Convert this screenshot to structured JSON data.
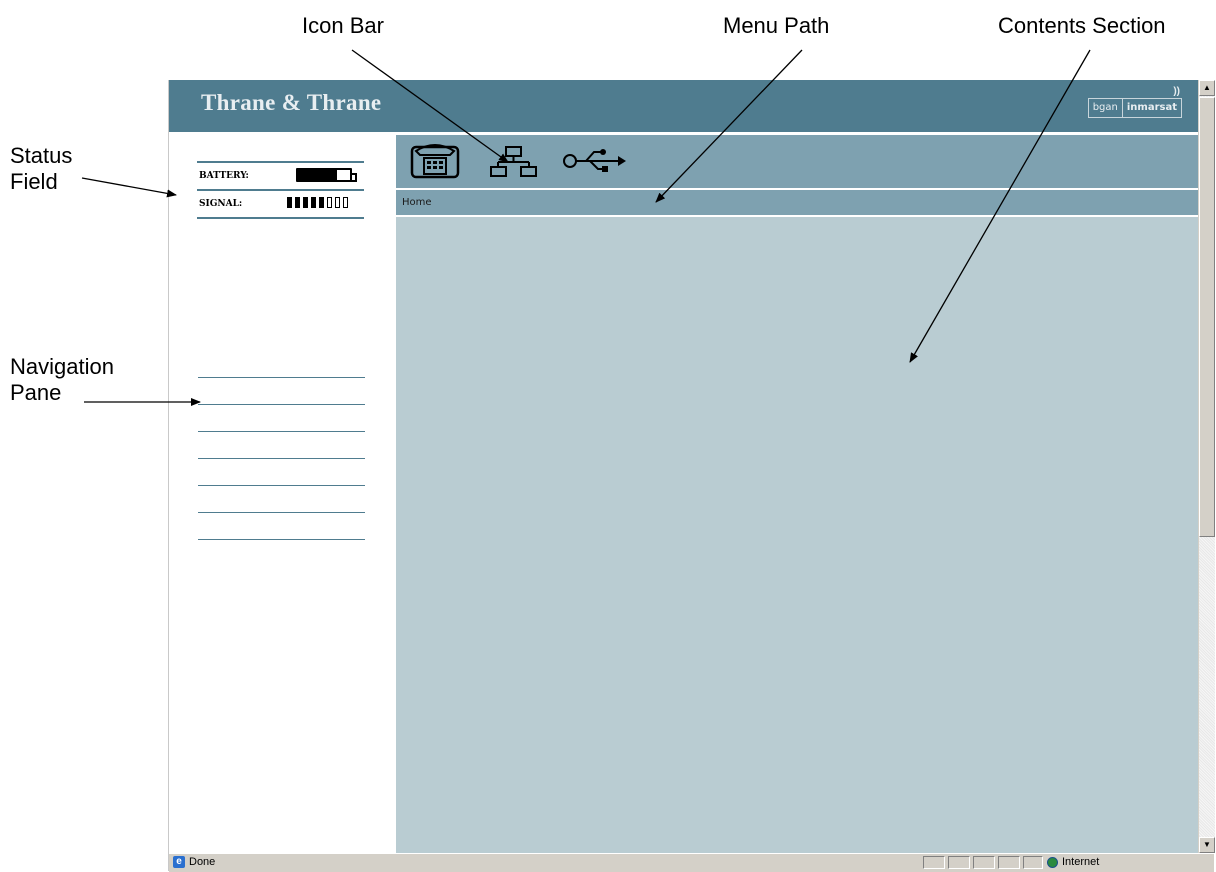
{
  "callouts": {
    "icon_bar": "Icon Bar",
    "menu_path": "Menu Path",
    "contents_section": "Contents Section",
    "status_field_line1": "Status",
    "status_field_line2": "Field",
    "navigation_pane_line1": "Navigation",
    "navigation_pane_line2": "Pane"
  },
  "banner": {
    "brand": "Thrane & Thrane",
    "logo_left": "bgan",
    "logo_right": "inmarsat"
  },
  "status": {
    "battery_label": "BATTERY:",
    "battery_level": 0.75,
    "signal_label": "SIGNAL:",
    "signal_bars_on": 5,
    "signal_bars_total": 8
  },
  "icons": [
    "phone-icon",
    "network-icon",
    "usb-icon"
  ],
  "menu_path": "Home",
  "browser_status": {
    "left_text": "Done",
    "zone_text": "Internet"
  },
  "colors": {
    "banner": "#4f7c8f",
    "iconbar": "#7ea1b0",
    "contents": "#b9ccd2"
  }
}
